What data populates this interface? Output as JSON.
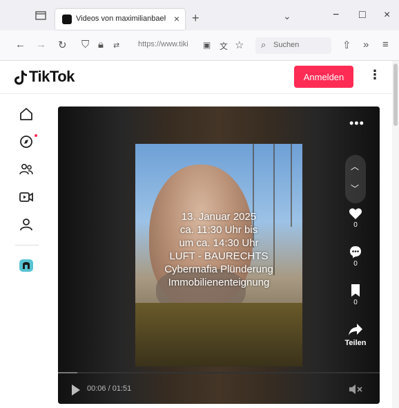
{
  "browser": {
    "tab_title": "Videos von maximilianbaehring",
    "tab_close": "×",
    "new_tab": "+",
    "url": "https://www.tiki",
    "search_placeholder": "Suchen",
    "window_buttons": [
      "−",
      "□",
      "×"
    ]
  },
  "header": {
    "logo_text": "TikTok",
    "login_label": "Anmelden",
    "more_label": "⋮"
  },
  "sidebar": {
    "items": [
      {
        "icon": "home-icon"
      },
      {
        "icon": "explore-icon"
      },
      {
        "icon": "following-icon"
      },
      {
        "icon": "live-icon"
      },
      {
        "icon": "profile-icon"
      },
      {
        "icon": "creator-icon"
      }
    ]
  },
  "video": {
    "overlay_lines": [
      "13. Januar 2025",
      "ca. 11:30 Uhr bis",
      "um ca. 14:30 Uhr",
      "LUFT - BAURECHTS",
      "Cybermafia Plünderung",
      "Immobilienenteignung"
    ],
    "more_label": "•••",
    "likes": "0",
    "comments": "0",
    "saves": "0",
    "share_label": "Teilen",
    "time": "00:06 / 01:51",
    "progress": 0.06
  },
  "colors": {
    "accent": "#fe2c55",
    "chrome_bg": "#f0f0f4"
  }
}
